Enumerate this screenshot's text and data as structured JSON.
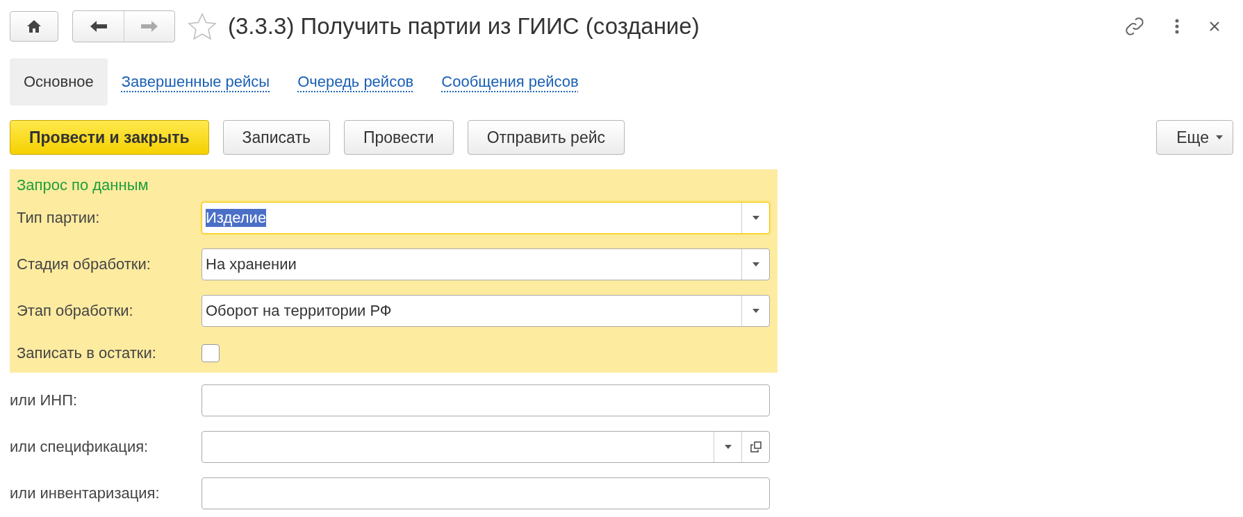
{
  "window": {
    "title": "(3.3.3) Получить партии из ГИИС (создание)",
    "favorite": false
  },
  "tabs": [
    {
      "label": "Основное",
      "selected": true
    },
    {
      "label": "Завершенные рейсы",
      "selected": false
    },
    {
      "label": "Очередь рейсов",
      "selected": false
    },
    {
      "label": "Сообщения рейсов",
      "selected": false
    }
  ],
  "toolbar": {
    "buttons": [
      {
        "label": "Провести и закрыть",
        "kind": "primary"
      },
      {
        "label": "Записать",
        "kind": "normal"
      },
      {
        "label": "Провести",
        "kind": "normal"
      },
      {
        "label": "Отправить рейс",
        "kind": "normal"
      }
    ],
    "more": {
      "label": "Еще"
    }
  },
  "group": {
    "title": "Запрос по данным",
    "fields": [
      {
        "label": "Тип партии:",
        "kind": "dropdown",
        "value": "Изделие",
        "focused": true
      },
      {
        "label": "Стадия обработки:",
        "kind": "dropdown",
        "value": "На хранении",
        "focused": false
      },
      {
        "label": "Этап обработки:",
        "kind": "dropdown",
        "value": "Оборот на территории РФ",
        "focused": false
      },
      {
        "label": "Записать в остатки:",
        "kind": "checkbox",
        "checked": false
      }
    ]
  },
  "fields": [
    {
      "label": "или ИНП:",
      "kind": "text",
      "focused": false
    },
    {
      "label": "или спецификация:",
      "kind": "dropdown_open",
      "focused": false
    },
    {
      "label": "или инвентаризация:",
      "kind": "text",
      "focused": false
    }
  ]
}
